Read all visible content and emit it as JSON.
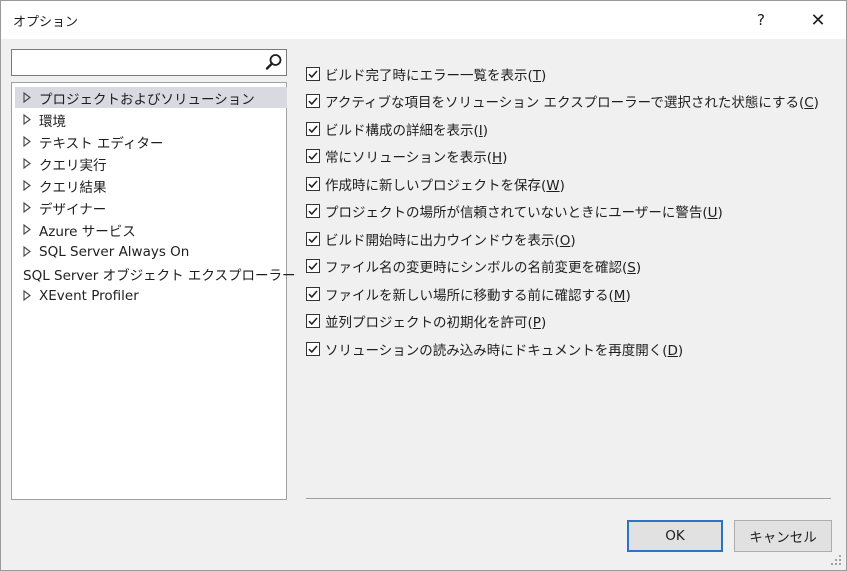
{
  "window": {
    "title": "オプション",
    "help_label": "?",
    "close_label": "✕"
  },
  "search": {
    "value": "",
    "placeholder": ""
  },
  "tree": {
    "items": [
      {
        "label": "プロジェクトおよびソリューション",
        "selected": true
      },
      {
        "label": "環境"
      },
      {
        "label": "テキスト エディター"
      },
      {
        "label": "クエリ実行"
      },
      {
        "label": "クエリ結果"
      },
      {
        "label": "デザイナー"
      },
      {
        "label": "Azure サービス"
      },
      {
        "label": "SQL Server Always On"
      },
      {
        "label": "SQL Server オブジェクト エクスプローラー"
      },
      {
        "label": "XEvent Profiler"
      }
    ]
  },
  "options": {
    "items": [
      {
        "text": "ビルド完了時にエラー一覧を表示(",
        "key": "T",
        "end": ")",
        "checked": true
      },
      {
        "text": "アクティブな項目をソリューション エクスプローラーで選択された状態にする(",
        "key": "C",
        "end": ")",
        "checked": true
      },
      {
        "text": "ビルド構成の詳細を表示(",
        "key": "I",
        "end": ")",
        "checked": true
      },
      {
        "text": "常にソリューションを表示(",
        "key": "H",
        "end": ")",
        "checked": true
      },
      {
        "text": "作成時に新しいプロジェクトを保存(",
        "key": "W",
        "end": ")",
        "checked": true
      },
      {
        "text": "プロジェクトの場所が信頼されていないときにユーザーに警告(",
        "key": "U",
        "end": ")",
        "checked": true
      },
      {
        "text": "ビルド開始時に出力ウインドウを表示(",
        "key": "O",
        "end": ")",
        "checked": true
      },
      {
        "text": "ファイル名の変更時にシンボルの名前変更を確認(",
        "key": "S",
        "end": ")",
        "checked": true
      },
      {
        "text": "ファイルを新しい場所に移動する前に確認する(",
        "key": "M",
        "end": ")",
        "checked": true
      },
      {
        "text": "並列プロジェクトの初期化を許可(",
        "key": "P",
        "end": ")",
        "checked": true
      },
      {
        "text": "ソリューションの読み込み時にドキュメントを再度開く(",
        "key": "D",
        "end": ")",
        "checked": true
      }
    ]
  },
  "buttons": {
    "ok_label": "OK",
    "cancel_label": "キャンセル"
  }
}
